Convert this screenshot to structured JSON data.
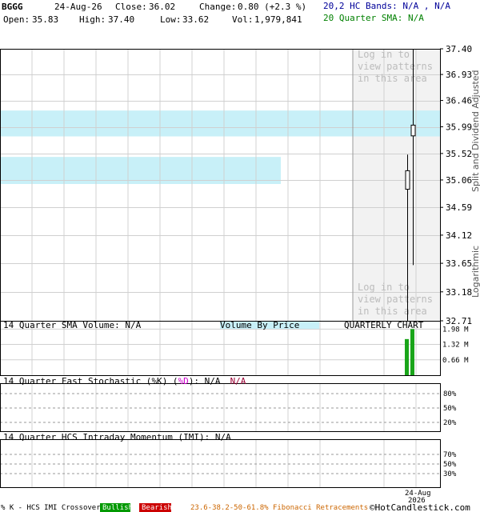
{
  "header": {
    "symbol": "BGGG",
    "date": "24-Aug-26",
    "close_label": "Close:",
    "close": "36.02",
    "change_label": "Change:",
    "change": "0.80 (+2.3 %)",
    "open_label": "Open:",
    "open": "35.83",
    "high_label": "High:",
    "high": "37.40",
    "low_label": "Low:",
    "low": "33.62",
    "vol_label": "Vol:",
    "vol": "1,979,841",
    "hc_bands": "20,2 HC Bands: N/A , N/A",
    "sma20": "20 Quarter SMA: N/A"
  },
  "price_panel": {
    "watermark_top": [
      "Log in to",
      "view patterns",
      "in this area"
    ],
    "watermark_bottom": [
      "Log in to",
      "view patterns",
      "in this area"
    ],
    "right_axis_label_top": "Split and Dividend Adjusted",
    "right_axis_label_bottom": "Logarithmic"
  },
  "volume_panel": {
    "sma_label": "14 Quarter SMA Volume: N/A",
    "vbp_label": "Volume By Price",
    "chart_label": "QUARTERLY CHART",
    "ticks": [
      "1.98 M",
      "1.32 M",
      "0.66 M"
    ]
  },
  "stoch_panel": {
    "label_a": "14 Quarter Fast Stochastic (",
    "label_k": "%K",
    "label_b": ") (",
    "label_d": "%D",
    "label_c": "): N/A",
    "label_na": "N/A",
    "ticks": [
      "80%",
      "50%",
      "20%"
    ]
  },
  "imi_panel": {
    "label": "14 Quarter HCS Intraday Momentum (IMI): N/A",
    "ticks": [
      "70%",
      "50%",
      "30%"
    ]
  },
  "footer": {
    "legend_a": "% K - HCS IMI Crossover,",
    "bullish": "Bullish",
    "bearish": "Bearish",
    "fib": "23.6-38.2-50-61.8% Fibonacci Retracements",
    "copyright": "©HotCandlestick.com",
    "date_top": "24-Aug",
    "date_bottom": "2026"
  },
  "colors": {
    "up": "#000000",
    "volume": "#1aa51a",
    "vbp_band": "#c8f0f8",
    "grid": "#d0d0d0",
    "watermark": "#bcbcbc",
    "pattern_area": "#f2f2f2",
    "hc_bands_text": "#000099",
    "sma_text": "#008000",
    "stoch_d": "#cc00cc",
    "stoch_na": "#990033",
    "fib_text": "#cc6600",
    "bullish_bg": "#009900",
    "bearish_bg": "#cc0000"
  },
  "chart_data": {
    "type": "candlestick",
    "scale": "logarithmic",
    "ylim": [
      32.71,
      37.4
    ],
    "yticks": [
      37.4,
      36.93,
      36.46,
      35.99,
      35.52,
      35.06,
      34.59,
      34.12,
      33.65,
      33.18,
      32.71
    ],
    "candles": [
      {
        "open": 34.9,
        "high": 35.5,
        "low": 32.71,
        "close": 35.22
      },
      {
        "open": 35.83,
        "high": 37.4,
        "low": 33.62,
        "close": 36.02
      }
    ],
    "volume": {
      "ylim": [
        0,
        2.3
      ],
      "unit": "M",
      "values": [
        1.55,
        1.98
      ]
    },
    "volume_by_price": [
      {
        "from": 35.82,
        "to": 36.28,
        "relative": 1.0
      },
      {
        "from": 34.99,
        "to": 35.46,
        "relative": 0.82
      }
    ],
    "stochastic": {
      "k": null,
      "d": null,
      "levels": [
        80,
        50,
        20
      ]
    },
    "imi": {
      "value": null,
      "levels": [
        70,
        50,
        30
      ]
    },
    "x_date": "24-Aug-2026"
  }
}
